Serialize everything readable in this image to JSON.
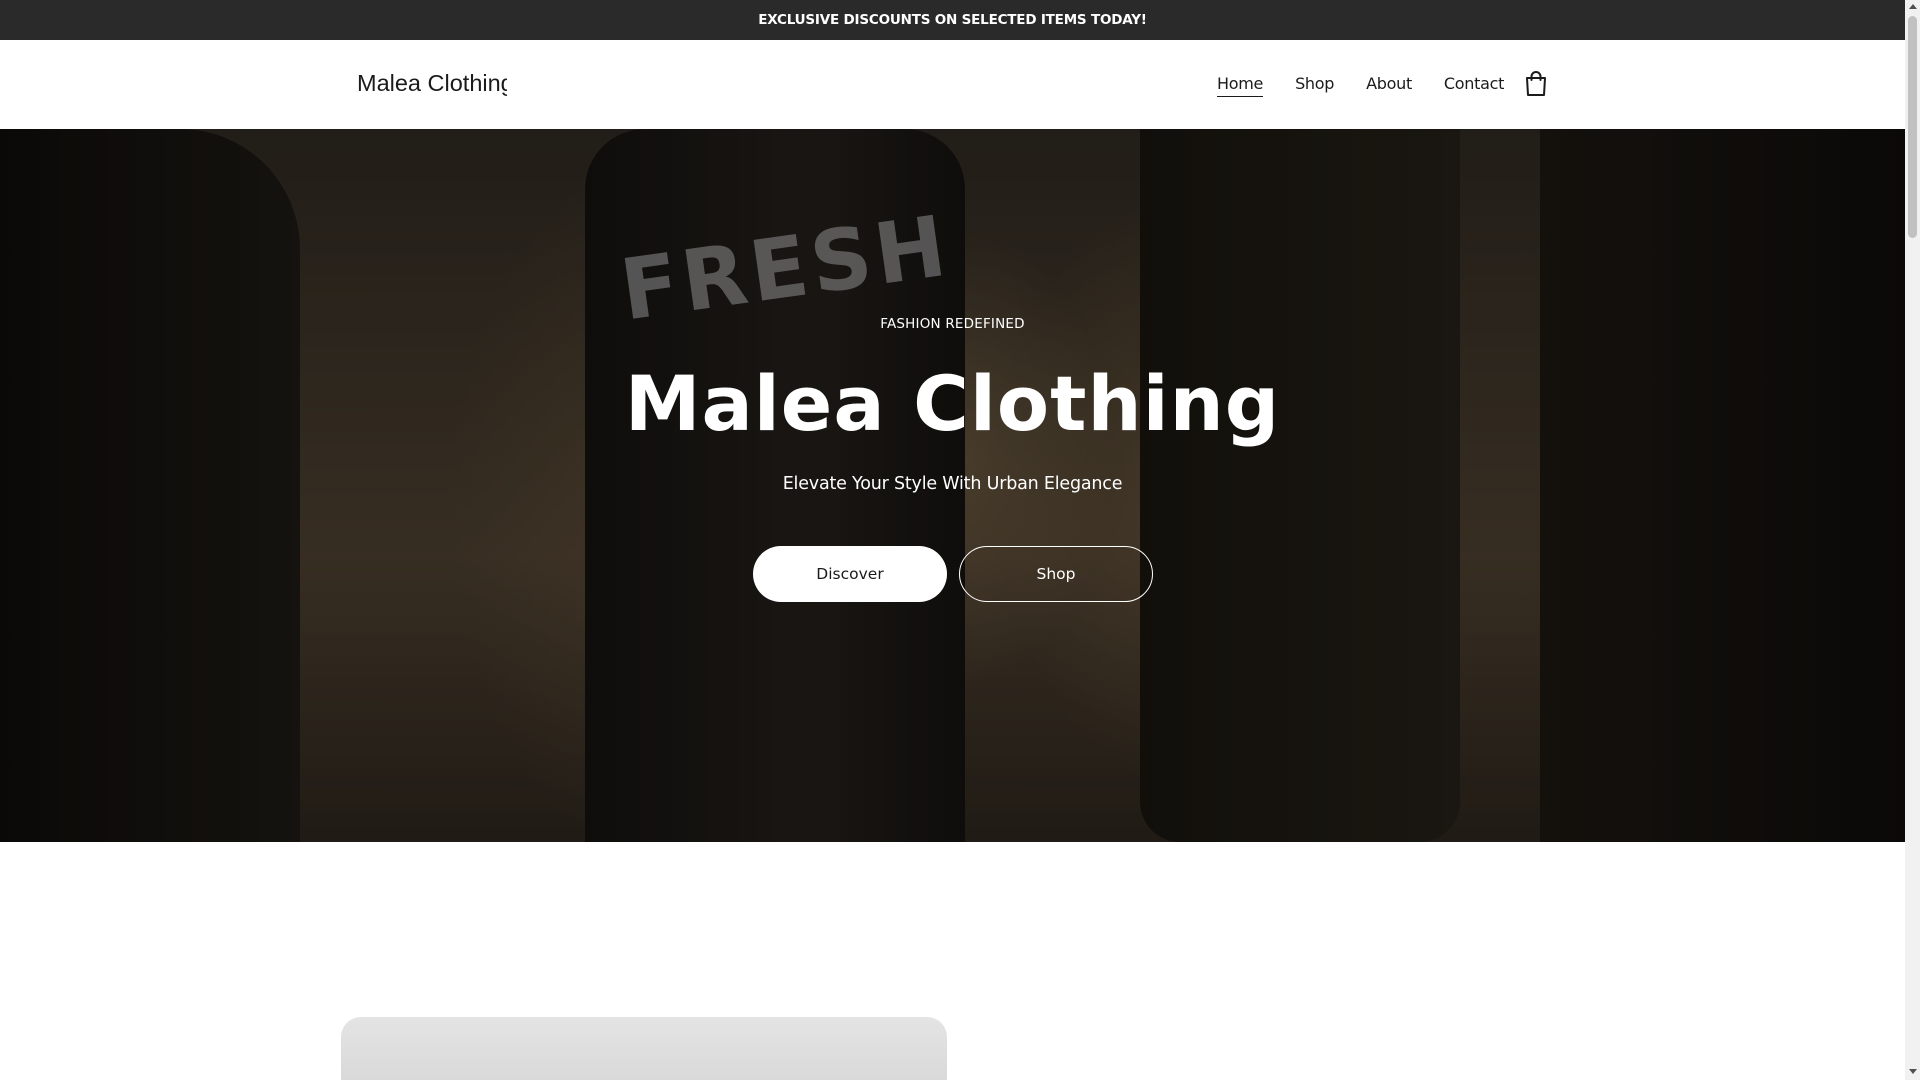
{
  "announcement": {
    "text": "EXCLUSIVE DISCOUNTS ON SELECTED ITEMS TODAY!"
  },
  "header": {
    "logo_text": "Malea Clothing",
    "nav": [
      {
        "label": "Home",
        "active": true
      },
      {
        "label": "Shop",
        "active": false
      },
      {
        "label": "About",
        "active": false
      },
      {
        "label": "Contact",
        "active": false
      }
    ],
    "cart_icon": "shopping-bag-icon"
  },
  "hero": {
    "background_text": "FRESH",
    "eyebrow": "FASHION REDEFINED",
    "title": "Malea Clothing",
    "subtitle": "Elevate Your Style With Urban Elegance",
    "primary_button": "Discover",
    "secondary_button": "Shop"
  },
  "colors": {
    "announcement_bg": "#2a2a2a",
    "text_dark": "#1b1b1b",
    "white": "#ffffff"
  }
}
